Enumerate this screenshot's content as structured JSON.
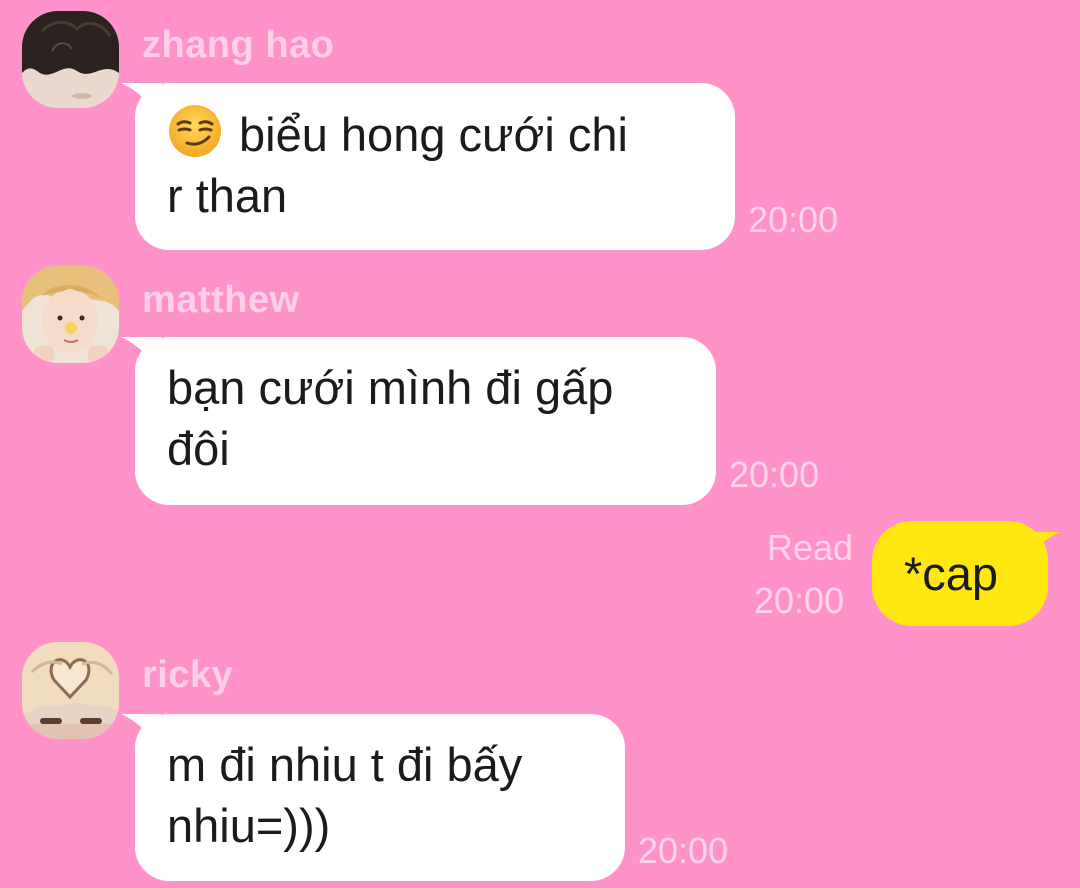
{
  "colors": {
    "background": "#ff93c9",
    "received_bubble": "#ffffff",
    "sent_bubble": "#ffe812",
    "meta_text": "rgba(255,255,255,0.6)"
  },
  "messages": [
    {
      "sender": "zhang hao",
      "avatar_icon": "avatar-photo",
      "emoji_icon": "smirking-face-icon",
      "text": "biểu hong cưới chi\nr than",
      "time": "20:00"
    },
    {
      "sender": "matthew",
      "avatar_icon": "avatar-photo",
      "text": "bạn cưới mình đi gấp\nđôi",
      "time": "20:00"
    },
    {
      "sender": "ricky",
      "avatar_icon": "avatar-photo",
      "text": "m đi nhiu t đi bấy\nnhiu=)))",
      "time": "20:00"
    }
  ],
  "my_message": {
    "text": "*cap",
    "read_label": "Read",
    "time": "20:00"
  }
}
